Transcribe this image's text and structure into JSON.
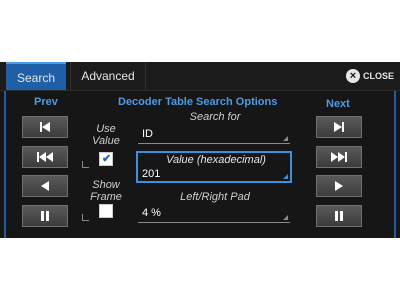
{
  "tabs": {
    "search": "Search",
    "advanced": "Advanced"
  },
  "close_label": "CLOSE",
  "title": "Decoder Table Search Options",
  "prev_label": "Prev",
  "next_label": "Next",
  "use_value": {
    "label": "Use Value",
    "checked": true
  },
  "show_frame": {
    "label": "Show Frame",
    "checked": false
  },
  "search_for": {
    "label": "Search for",
    "value": "ID"
  },
  "value_field": {
    "label": "Value (hexadecimal)",
    "value": "201"
  },
  "pad": {
    "label": "Left/Right Pad",
    "value": "4 %"
  },
  "icons": {
    "prev": [
      "skip-first-icon",
      "fast-rewind-icon",
      "step-back-icon",
      "pause-icon"
    ],
    "next": [
      "skip-last-icon",
      "fast-forward-icon",
      "step-forward-icon",
      "pause-icon"
    ]
  },
  "colors": {
    "accent": "#1f5fa8",
    "header": "#4d9ae6",
    "background": "#141414"
  }
}
